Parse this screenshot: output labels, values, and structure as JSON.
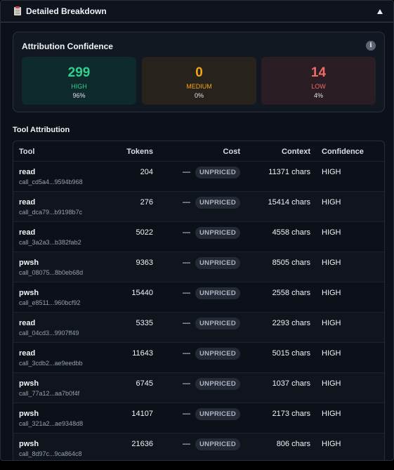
{
  "panel": {
    "title": "Detailed Breakdown"
  },
  "confidence": {
    "title": "Attribution Confidence",
    "info": "i",
    "high": {
      "count": "299",
      "label": "HIGH",
      "percent": "96%"
    },
    "medium": {
      "count": "0",
      "label": "MEDIUM",
      "percent": "0%"
    },
    "low": {
      "count": "14",
      "label": "LOW",
      "percent": "4%"
    },
    "colors": {
      "high": "#2fd08e",
      "medium": "#f2a516",
      "low": "#f06a6a"
    }
  },
  "tool_attribution": {
    "title": "Tool Attribution",
    "columns": {
      "tool": "Tool",
      "tokens": "Tokens",
      "cost": "Cost",
      "context": "Context",
      "confidence": "Confidence"
    },
    "rows": [
      {
        "tool": "read",
        "call_id": "call_cd5a4...9594b968",
        "tokens": "204",
        "cost_dash": "—",
        "cost_badge": "UNPRICED",
        "context": "11371 chars",
        "confidence": "HIGH"
      },
      {
        "tool": "read",
        "call_id": "call_dca79...b9198b7c",
        "tokens": "276",
        "cost_dash": "—",
        "cost_badge": "UNPRICED",
        "context": "15414 chars",
        "confidence": "HIGH"
      },
      {
        "tool": "read",
        "call_id": "call_3a2a3...b382fab2",
        "tokens": "5022",
        "cost_dash": "—",
        "cost_badge": "UNPRICED",
        "context": "4558 chars",
        "confidence": "HIGH"
      },
      {
        "tool": "pwsh",
        "call_id": "call_08075...8b0eb68d",
        "tokens": "9363",
        "cost_dash": "—",
        "cost_badge": "UNPRICED",
        "context": "8505 chars",
        "confidence": "HIGH"
      },
      {
        "tool": "pwsh",
        "call_id": "call_e8511...960bcf92",
        "tokens": "15440",
        "cost_dash": "—",
        "cost_badge": "UNPRICED",
        "context": "2558 chars",
        "confidence": "HIGH"
      },
      {
        "tool": "read",
        "call_id": "call_04cd3...9907ff49",
        "tokens": "5335",
        "cost_dash": "—",
        "cost_badge": "UNPRICED",
        "context": "2293 chars",
        "confidence": "HIGH"
      },
      {
        "tool": "read",
        "call_id": "call_3cdb2...ae9eedbb",
        "tokens": "11643",
        "cost_dash": "—",
        "cost_badge": "UNPRICED",
        "context": "5015 chars",
        "confidence": "HIGH"
      },
      {
        "tool": "pwsh",
        "call_id": "call_77a12...aa7b0f4f",
        "tokens": "6745",
        "cost_dash": "—",
        "cost_badge": "UNPRICED",
        "context": "1037 chars",
        "confidence": "HIGH"
      },
      {
        "tool": "pwsh",
        "call_id": "call_321a2...ae9348d8",
        "tokens": "14107",
        "cost_dash": "—",
        "cost_badge": "UNPRICED",
        "context": "2173 chars",
        "confidence": "HIGH"
      },
      {
        "tool": "pwsh",
        "call_id": "call_8d97c...9ca864c8",
        "tokens": "21636",
        "cost_dash": "—",
        "cost_badge": "UNPRICED",
        "context": "806 chars",
        "confidence": "HIGH"
      }
    ]
  }
}
